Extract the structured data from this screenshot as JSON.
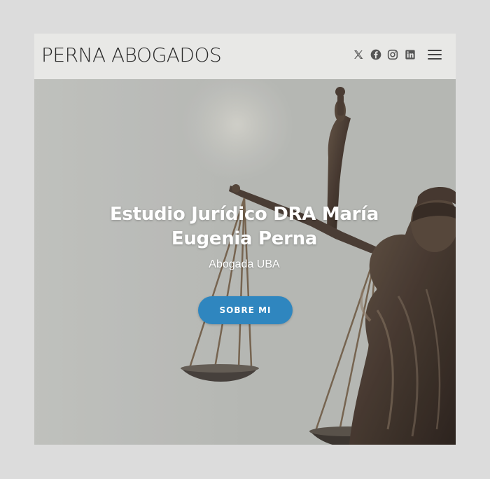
{
  "header": {
    "brand": "PERNA ABOGADOS",
    "social": [
      {
        "icon": "x-twitter-icon"
      },
      {
        "icon": "facebook-icon"
      },
      {
        "icon": "instagram-icon"
      },
      {
        "icon": "linkedin-icon"
      }
    ],
    "menu_icon": "hamburger-menu-icon"
  },
  "hero": {
    "title": "Estudio Jurídico DRA María Eugenia Perna",
    "subtitle": "Abogada UBA",
    "cta_label": "SOBRE MI",
    "background": "justice-statue-scales-image"
  },
  "colors": {
    "page_bg": "#dcdcdc",
    "header_bg": "#e8e8e6",
    "accent": "#2f86bf",
    "icon_color": "#555555"
  }
}
